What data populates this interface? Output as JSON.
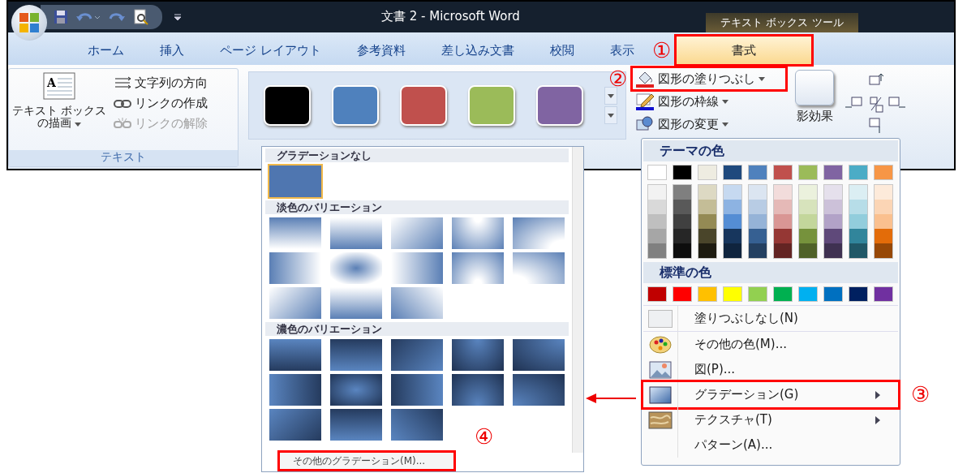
{
  "window": {
    "title": "文書 2 - Microsoft Word",
    "context_title": "テキスト ボックス ツール"
  },
  "tabs": [
    {
      "label": "ホーム",
      "selected": false
    },
    {
      "label": "挿入",
      "selected": false
    },
    {
      "label": "ページ レイアウト",
      "selected": false
    },
    {
      "label": "参考資料",
      "selected": false
    },
    {
      "label": "差し込み文書",
      "selected": false
    },
    {
      "label": "校閲",
      "selected": false
    },
    {
      "label": "表示",
      "selected": false
    },
    {
      "label": "書式",
      "selected": true,
      "marker": "①"
    }
  ],
  "text_group": {
    "icon_letter": "A",
    "draw_button": [
      "テキスト ボックス",
      "の描画"
    ],
    "label": "テキスト",
    "items": [
      {
        "label": "文字列の方向",
        "kind": "direction",
        "disabled": false
      },
      {
        "label": "リンクの作成",
        "kind": "link",
        "disabled": false
      },
      {
        "label": "リンクの解除",
        "kind": "unlink",
        "disabled": true
      }
    ]
  },
  "styles": [
    {
      "color": "#000000"
    },
    {
      "color": "#4f81bd"
    },
    {
      "color": "#c0504d"
    },
    {
      "color": "#9bbb59"
    },
    {
      "color": "#8064a2"
    }
  ],
  "shape_commands": [
    {
      "label": "図形の塗りつぶし",
      "kind": "fill",
      "marker": "②"
    },
    {
      "label": "図形の枠線",
      "kind": "outline"
    },
    {
      "label": "図形の変更",
      "kind": "change"
    }
  ],
  "shadow_button": "影効果",
  "gradient_gallery": {
    "sections": [
      {
        "title": "グラデーションなし",
        "kind": "none",
        "tiles": [
          {
            "selected": true
          }
        ]
      },
      {
        "title": "淡色のバリエーション",
        "kind": "light"
      },
      {
        "title": "濃色のバリエーション",
        "kind": "dark"
      }
    ],
    "footer": {
      "label": "その他のグラデーション(M)...",
      "marker": "④"
    }
  },
  "color_menu": {
    "theme_title": "テーマの色",
    "theme_colors": [
      {
        "color": "#ffffff",
        "shades": [
          {
            "color": "#f2f2f2"
          },
          {
            "color": "#d9d9d9"
          },
          {
            "color": "#bfbfbf"
          },
          {
            "color": "#a6a6a6"
          },
          {
            "color": "#808080"
          }
        ]
      },
      {
        "color": "#000000",
        "shades": [
          {
            "color": "#7f7f7f"
          },
          {
            "color": "#595959"
          },
          {
            "color": "#404040"
          },
          {
            "color": "#262626"
          },
          {
            "color": "#0d0d0d"
          }
        ]
      },
      {
        "color": "#eeece1",
        "shades": [
          {
            "color": "#ddd9c3"
          },
          {
            "color": "#c4bd97"
          },
          {
            "color": "#948a54"
          },
          {
            "color": "#4a452a"
          },
          {
            "color": "#1d1b10"
          }
        ]
      },
      {
        "color": "#1f497d",
        "shades": [
          {
            "color": "#c6d9f0"
          },
          {
            "color": "#8db3e2"
          },
          {
            "color": "#548dd4"
          },
          {
            "color": "#17365d"
          },
          {
            "color": "#0f243e"
          }
        ]
      },
      {
        "color": "#4f81bd",
        "shades": [
          {
            "color": "#dbe5f1"
          },
          {
            "color": "#b8cce4"
          },
          {
            "color": "#95b3d7"
          },
          {
            "color": "#366092"
          },
          {
            "color": "#244061"
          }
        ]
      },
      {
        "color": "#c0504d",
        "shades": [
          {
            "color": "#f2dcdb"
          },
          {
            "color": "#e5b9b7"
          },
          {
            "color": "#d99694"
          },
          {
            "color": "#953734"
          },
          {
            "color": "#632423"
          }
        ]
      },
      {
        "color": "#9bbb59",
        "shades": [
          {
            "color": "#ebf1dd"
          },
          {
            "color": "#d7e3bc"
          },
          {
            "color": "#c3d69b"
          },
          {
            "color": "#76923c"
          },
          {
            "color": "#4f6128"
          }
        ]
      },
      {
        "color": "#8064a2",
        "shades": [
          {
            "color": "#e5e0ec"
          },
          {
            "color": "#ccc1d9"
          },
          {
            "color": "#b2a2c7"
          },
          {
            "color": "#5f497a"
          },
          {
            "color": "#3f3151"
          }
        ]
      },
      {
        "color": "#4bacc6",
        "shades": [
          {
            "color": "#dbeef3"
          },
          {
            "color": "#b7dde8"
          },
          {
            "color": "#92cddc"
          },
          {
            "color": "#31859b"
          },
          {
            "color": "#205867"
          }
        ]
      },
      {
        "color": "#f79646",
        "shades": [
          {
            "color": "#fdeada"
          },
          {
            "color": "#fbd5b5"
          },
          {
            "color": "#fac08f"
          },
          {
            "color": "#e36c09"
          },
          {
            "color": "#974806"
          }
        ]
      }
    ],
    "standard_title": "標準の色",
    "standard_colors": [
      {
        "color": "#c00000"
      },
      {
        "color": "#ff0000"
      },
      {
        "color": "#ffc000"
      },
      {
        "color": "#ffff00"
      },
      {
        "color": "#92d050"
      },
      {
        "color": "#00b050"
      },
      {
        "color": "#00b0f0"
      },
      {
        "color": "#0070c0"
      },
      {
        "color": "#002060"
      },
      {
        "color": "#7030a0"
      }
    ],
    "items": [
      {
        "label": "塗りつぶしなし(N)",
        "kind": "no-fill",
        "submenu": false
      },
      {
        "label": "その他の色(M)...",
        "kind": "palette",
        "submenu": false
      },
      {
        "label": "図(P)...",
        "kind": "picture",
        "submenu": false
      },
      {
        "label": "グラデーション(G)",
        "kind": "gradient",
        "submenu": true,
        "marker": "③"
      },
      {
        "label": "テクスチャ(T)",
        "kind": "texture",
        "submenu": true
      },
      {
        "label": "パターン(A)...",
        "kind": "plain",
        "submenu": false
      }
    ]
  }
}
